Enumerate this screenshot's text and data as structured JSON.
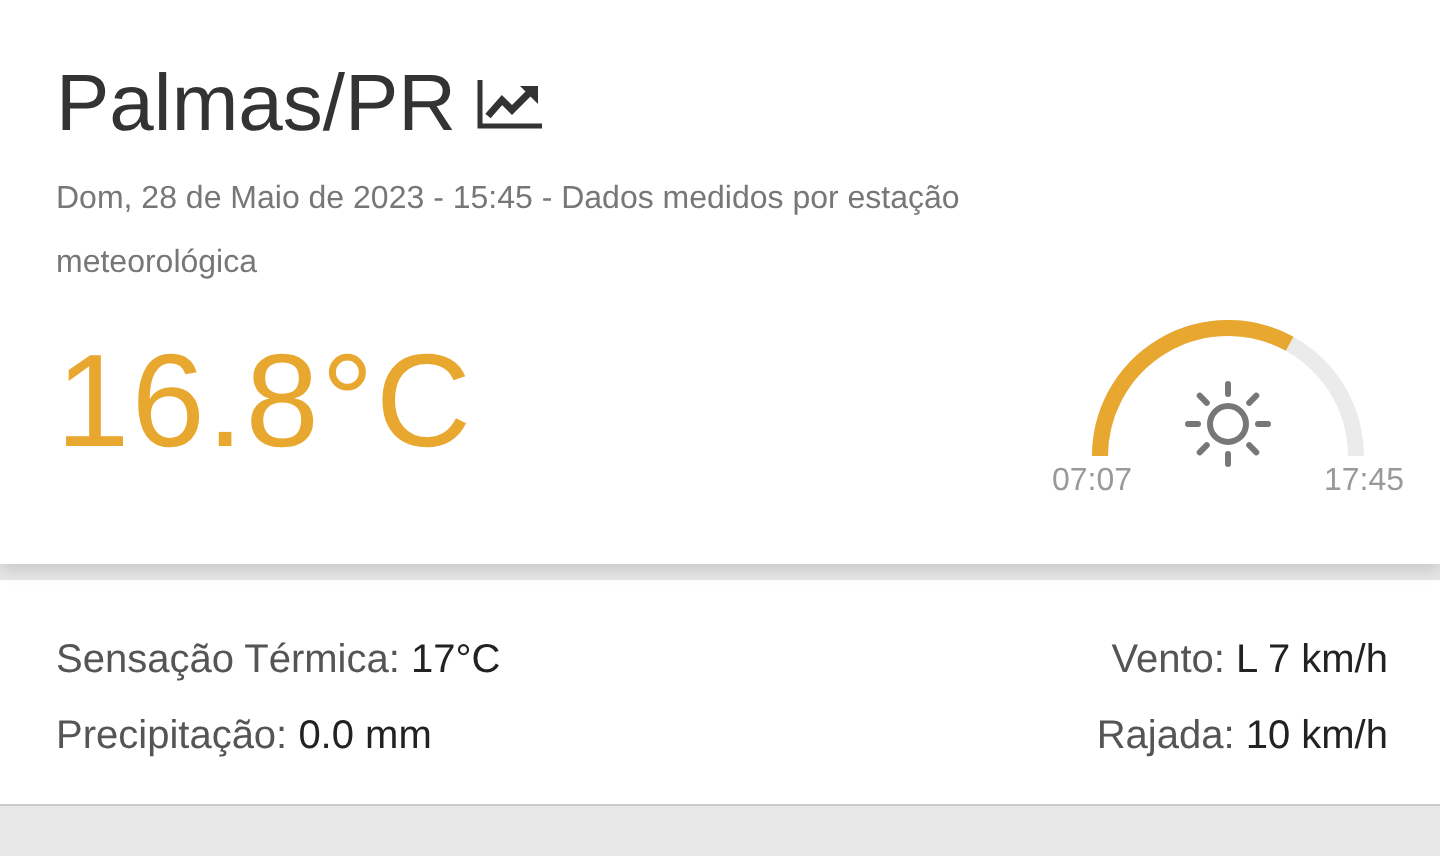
{
  "city": {
    "name": "Palmas/PR"
  },
  "subtitle": "Dom, 28 de Maio de 2023 - 15:45 - Dados medidos por estação meteorológica",
  "temperature": "16.8°C",
  "sun": {
    "sunrise": "07:07",
    "sunset": "17:45"
  },
  "left_details": [
    {
      "label": "Sensação Térmica:",
      "value": "17°C"
    },
    {
      "label": "Precipitação:",
      "value": "0.0 mm"
    }
  ],
  "right_details": [
    {
      "label": "Vento:",
      "value": "L 7 km/h"
    },
    {
      "label": "Rajada:",
      "value": "10 km/h"
    }
  ]
}
